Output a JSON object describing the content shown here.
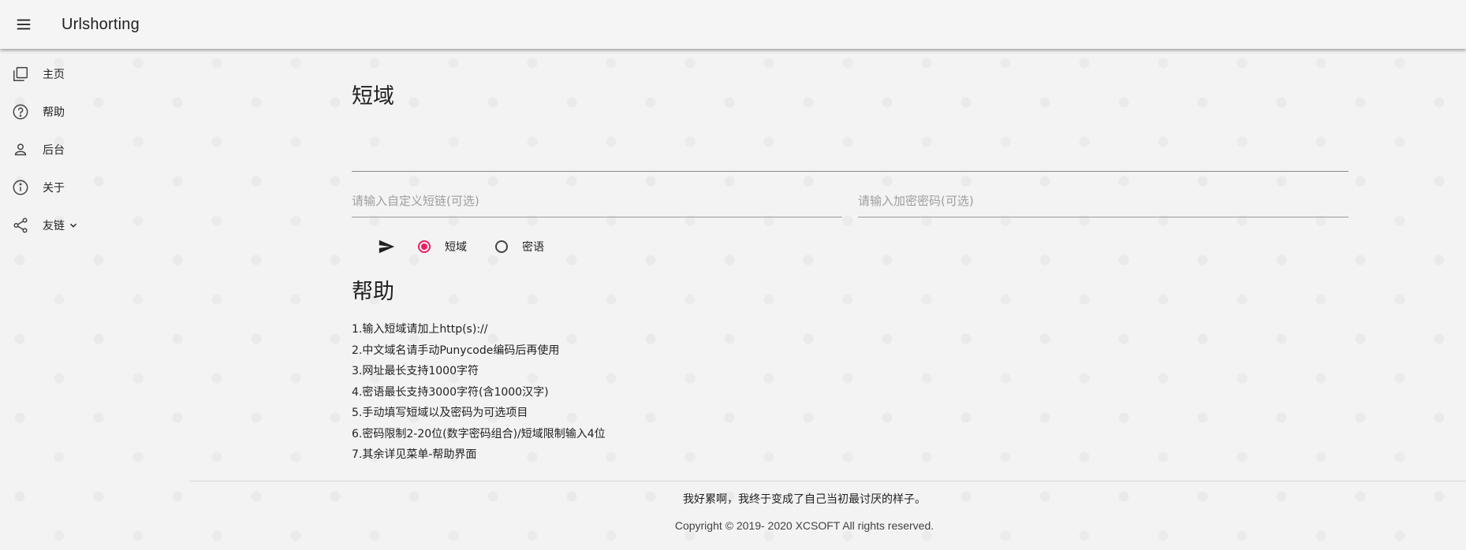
{
  "app": {
    "title": "Urlshorting"
  },
  "sidebar": {
    "items": [
      {
        "label": "主页",
        "icon": "copy-icon"
      },
      {
        "label": "帮助",
        "icon": "help-circle-icon"
      },
      {
        "label": "后台",
        "icon": "person-icon"
      },
      {
        "label": "关于",
        "icon": "info-icon"
      },
      {
        "label": "友链",
        "icon": "share-icon",
        "expand_icon": "chevron-down-icon"
      }
    ]
  },
  "main": {
    "title": "短域",
    "url_input": {
      "value": "",
      "placeholder": ""
    },
    "custom_short_input": {
      "value": "",
      "placeholder": "请输入自定义短链(可选)"
    },
    "password_input": {
      "value": "",
      "placeholder": "请输入加密密码(可选)"
    },
    "send_icon": "send-icon",
    "radios": [
      {
        "label": "短域",
        "checked": true
      },
      {
        "label": "密语",
        "checked": false
      }
    ],
    "accent_color": "#e91e63"
  },
  "help": {
    "title": "帮助",
    "items": [
      "1.输入短域请加上http(s)://",
      "2.中文域名请手动Punycode编码后再使用",
      "3.网址最长支持1000字符",
      "4.密语最长支持3000字符(含1000汉字)",
      "5.手动填写短域以及密码为可选项目",
      "6.密码限制2-20位(数字密码组合)/短域限制输入4位",
      "7.其余详见菜单-帮助界面"
    ]
  },
  "footer": {
    "quote": "我好累啊，我终于变成了自己当初最讨厌的样子。",
    "copyright": "Copyright © 2019- 2020 XCSOFT All rights reserved."
  }
}
